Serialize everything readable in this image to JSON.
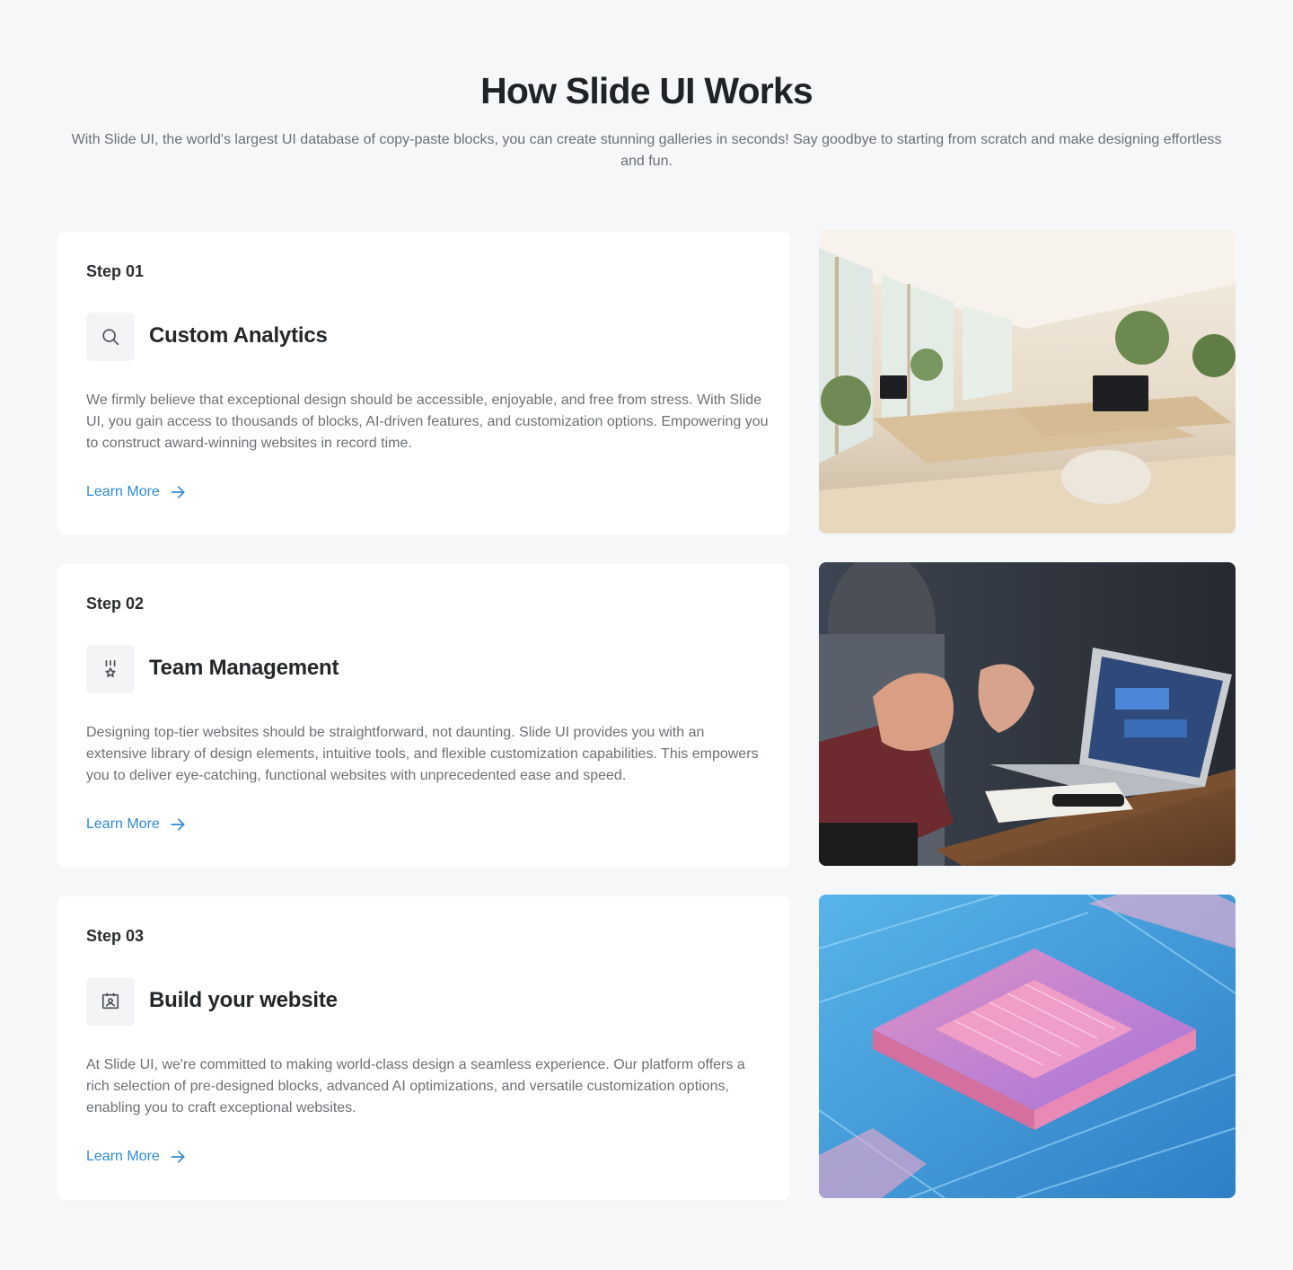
{
  "header": {
    "title": "How Slide UI Works",
    "subtitle": "With Slide UI, the world's largest UI database of copy-paste blocks, you can create stunning galleries in seconds! Say goodbye to starting from scratch and make designing effortless and fun."
  },
  "steps": [
    {
      "step_label": "Step 01",
      "icon": "search-icon",
      "title": "Custom Analytics",
      "description": "We firmly believe that exceptional design should be accessible, enjoyable, and free from stress. With Slide UI, you gain access to thousands of blocks, AI-driven features, and customization options. Empowering you to construct award-winning websites in record time.",
      "link_label": "Learn More",
      "image": "office-interior-photo"
    },
    {
      "step_label": "Step 02",
      "icon": "award-icon",
      "title": "Team Management",
      "description": "Designing top-tier websites should be straightforward, not daunting. Slide UI provides you with an extensive library of design elements, intuitive tools, and flexible customization capabilities. This empowers you to deliver eye-catching, functional websites with unprecedented ease and speed.",
      "link_label": "Learn More",
      "image": "meeting-laptop-photo"
    },
    {
      "step_label": "Step 03",
      "icon": "contact-card-icon",
      "title": "Build your website",
      "description": "At Slide UI, we're committed to making world-class design a seamless experience. Our platform offers a rich selection of pre-designed blocks, advanced AI optimizations, and versatile customization options, enabling you to craft exceptional websites.",
      "link_label": "Learn More",
      "image": "circuit-chip-photo"
    }
  ],
  "colors": {
    "background": "#f6f7f9",
    "card": "#ffffff",
    "link": "#2f8ad4",
    "heading": "#1f2326",
    "body_text": "#6c7176"
  }
}
